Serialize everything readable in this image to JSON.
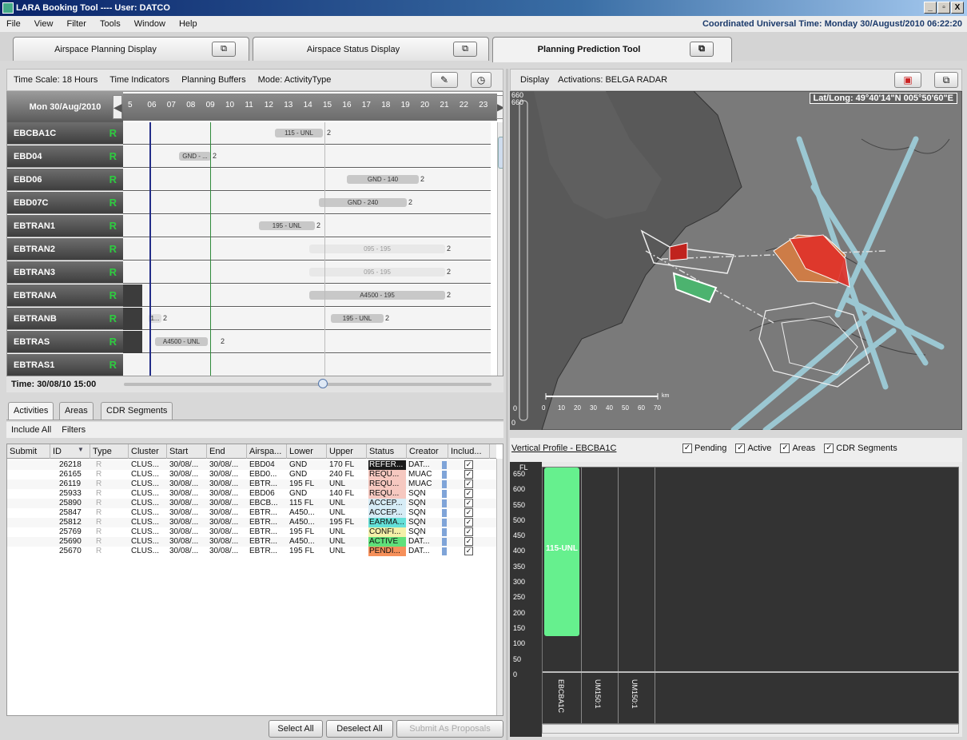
{
  "window": {
    "title": "LARA Booking Tool ---- User: DATCO",
    "min_label": "_",
    "max_label": "3",
    "close_label": "X"
  },
  "menu": {
    "items": [
      "File",
      "View",
      "Filter",
      "Tools",
      "Window",
      "Help"
    ],
    "utc": "Coordinated Universal Time: Monday 30/August/2010   06:22:20"
  },
  "main_tabs": [
    {
      "label": "Airspace Planning Display",
      "icon": "detach-window-icon"
    },
    {
      "label": "Airspace Status Display",
      "icon": "detach-window-icon"
    },
    {
      "label": "Planning Prediction Tool",
      "icon": "detach-window-icon"
    }
  ],
  "timeline_bar": {
    "items": [
      "Time Scale: 18 Hours",
      "Time Indicators",
      "Planning Buffers",
      "Mode: ActivityType"
    ]
  },
  "timeline": {
    "date": "Mon 30/Aug/2010",
    "hours": [
      "5",
      "06",
      "07",
      "08",
      "09",
      "10",
      "11",
      "12",
      "13",
      "14",
      "15",
      "16",
      "17",
      "18",
      "19",
      "20",
      "21",
      "22",
      "23"
    ],
    "rows": [
      {
        "name": "EBCBA1C",
        "status": "R",
        "bar": "115 - UNL",
        "num": "2"
      },
      {
        "name": "EBD04",
        "status": "R",
        "bar": "GND - ...",
        "num": "2"
      },
      {
        "name": "EBD06",
        "status": "R",
        "bar": "GND - 140",
        "num": "2"
      },
      {
        "name": "EBD07C",
        "status": "R",
        "bar": "GND - 240",
        "num": "2"
      },
      {
        "name": "EBTRAN1",
        "status": "R",
        "bar": "195 - UNL",
        "num": "2"
      },
      {
        "name": "EBTRAN2",
        "status": "R",
        "bar": "095 - 195",
        "num": "2"
      },
      {
        "name": "EBTRAN3",
        "status": "R",
        "bar": "095 - 195",
        "num": "2"
      },
      {
        "name": "EBTRANA",
        "status": "R",
        "bar": "A4500 - 195",
        "num": "2"
      },
      {
        "name": "EBTRANB",
        "status": "R",
        "bar": "195 - UNL",
        "num": "2",
        "bar2": "1...",
        "num2": "2"
      },
      {
        "name": "EBTRAS",
        "status": "R",
        "bar": "A4500 - UNL",
        "num": "2"
      },
      {
        "name": "EBTRAS1",
        "status": "R",
        "bar": "",
        "num": ""
      }
    ],
    "time_label": "Time: 30/08/10 15:00"
  },
  "subtabs": [
    "Activities",
    "Areas",
    "CDR Segments"
  ],
  "filter_row": [
    "Include All",
    "Filters"
  ],
  "grid": {
    "headers": [
      "Submit",
      "ID",
      "Type",
      "Cluster",
      "Start",
      "End",
      "Airspa...",
      "Lower",
      "Upper",
      "Status",
      "Creator",
      "Includ..."
    ],
    "rows": [
      {
        "id": "26218",
        "type": "R",
        "cluster": "CLUS...",
        "start": "30/08/...",
        "end": "30/08/...",
        "airspace": "EBD04",
        "lower": "GND",
        "upper": "170 FL",
        "status": "REFER...",
        "creator": "DAT...",
        "status_color": "#1a1a1a",
        "status_text": "#ffffff",
        "check": "✓"
      },
      {
        "id": "26165",
        "type": "R",
        "cluster": "CLUS...",
        "start": "30/08/...",
        "end": "30/08/...",
        "airspace": "EBD0...",
        "lower": "GND",
        "upper": "240 FL",
        "status": "REQU...",
        "creator": "MUAC",
        "status_color": "#f6c8c0",
        "status_text": "#111111",
        "check": "✓"
      },
      {
        "id": "26119",
        "type": "R",
        "cluster": "CLUS...",
        "start": "30/08/...",
        "end": "30/08/...",
        "airspace": "EBTR...",
        "lower": "195 FL",
        "upper": "UNL",
        "status": "REQU...",
        "creator": "MUAC",
        "status_color": "#f6c8c0",
        "status_text": "#111111",
        "check": "✓"
      },
      {
        "id": "25933",
        "type": "R",
        "cluster": "CLUS...",
        "start": "30/08/...",
        "end": "30/08/...",
        "airspace": "EBD06",
        "lower": "GND",
        "upper": "140 FL",
        "status": "REQU...",
        "creator": "SQN",
        "status_color": "#f6c8c0",
        "status_text": "#111111",
        "check": "✓"
      },
      {
        "id": "25890",
        "type": "R",
        "cluster": "CLUS...",
        "start": "30/08/...",
        "end": "30/08/...",
        "airspace": "EBCB...",
        "lower": "115 FL",
        "upper": "UNL",
        "status": "ACCEP...",
        "creator": "SQN",
        "status_color": "#d6ecf6",
        "status_text": "#111111",
        "check": "✓"
      },
      {
        "id": "25847",
        "type": "R",
        "cluster": "CLUS...",
        "start": "30/08/...",
        "end": "30/08/...",
        "airspace": "EBTR...",
        "lower": "A450...",
        "upper": "UNL",
        "status": "ACCEP...",
        "creator": "SQN",
        "status_color": "#d6ecf6",
        "status_text": "#111111",
        "check": "✓"
      },
      {
        "id": "25812",
        "type": "R",
        "cluster": "CLUS...",
        "start": "30/08/...",
        "end": "30/08/...",
        "airspace": "EBTR...",
        "lower": "A450...",
        "upper": "195 FL",
        "status": "EARMA...",
        "creator": "SQN",
        "status_color": "#64e0d8",
        "status_text": "#111111",
        "check": "✓"
      },
      {
        "id": "25769",
        "type": "R",
        "cluster": "CLUS...",
        "start": "30/08/...",
        "end": "30/08/...",
        "airspace": "EBTR...",
        "lower": "195 FL",
        "upper": "UNL",
        "status": "CONFI...",
        "creator": "SQN",
        "status_color": "#f4f0a8",
        "status_text": "#111111",
        "check": "✓"
      },
      {
        "id": "25690",
        "type": "R",
        "cluster": "CLUS...",
        "start": "30/08/...",
        "end": "30/08/...",
        "airspace": "EBTR...",
        "lower": "A450...",
        "upper": "UNL",
        "status": "ACTIVE",
        "creator": "DAT...",
        "status_color": "#5fe07a",
        "status_text": "#111111",
        "check": "✓"
      },
      {
        "id": "25670",
        "type": "R",
        "cluster": "CLUS...",
        "start": "30/08/...",
        "end": "30/08/...",
        "airspace": "EBTR...",
        "lower": "195 FL",
        "upper": "UNL",
        "status": "PENDI...",
        "creator": "DAT...",
        "status_color": "#f6905a",
        "status_text": "#111111",
        "check": "✓"
      }
    ]
  },
  "buttons": {
    "select_all": "Select All",
    "deselect_all": "Deselect All",
    "submit": "Submit As Proposals"
  },
  "right_bar": {
    "display": "Display",
    "activations": "Activations: BELGA RADAR"
  },
  "map": {
    "latlong": "Lat/Long:   49°40'14\"N  005°50'60\"E",
    "scale_top": "660",
    "scale_top2": "660",
    "scale_bottom": "0",
    "scale_bottom2": "0",
    "scale_labels": [
      "0",
      "10",
      "20",
      "30",
      "40",
      "50",
      "60",
      "70"
    ],
    "scale_unit": "km"
  },
  "vertical_profile": {
    "title": "Vertical Profile - EBCBA1C",
    "checks": [
      "Pending",
      "Active",
      "Areas",
      "CDR Segments"
    ],
    "fl_label": "FL",
    "yticks": [
      "650",
      "600",
      "550",
      "500",
      "450",
      "400",
      "350",
      "300",
      "250",
      "200",
      "150",
      "100",
      "50",
      "0"
    ],
    "columns": [
      "EBCBA1C",
      "UM150:1",
      "UM150:1"
    ],
    "block_label": "115-UNL",
    "block_lower": 115,
    "block_upper": 660,
    "y_max": 660
  }
}
